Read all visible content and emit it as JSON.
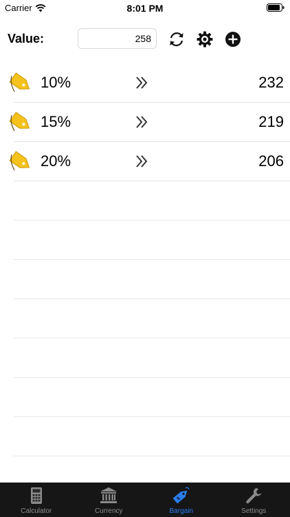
{
  "status_bar": {
    "carrier": "Carrier",
    "time": "8:01 PM"
  },
  "header": {
    "label": "Value:",
    "input_value": "258"
  },
  "rows": [
    {
      "percent": "10%",
      "result": "232"
    },
    {
      "percent": "15%",
      "result": "219"
    },
    {
      "percent": "20%",
      "result": "206"
    }
  ],
  "tab_bar": {
    "items": [
      {
        "label": "Calculator",
        "icon": "calculator-icon"
      },
      {
        "label": "Currency",
        "icon": "bank-icon"
      },
      {
        "label": "Bargain",
        "icon": "price-tag-icon"
      },
      {
        "label": "Settings",
        "icon": "wrench-icon"
      }
    ],
    "active": "Bargain"
  },
  "colors": {
    "accent": "#2a7df0",
    "tab_bar_bg": "#161616",
    "tag_yellow": "#f5c21b"
  }
}
